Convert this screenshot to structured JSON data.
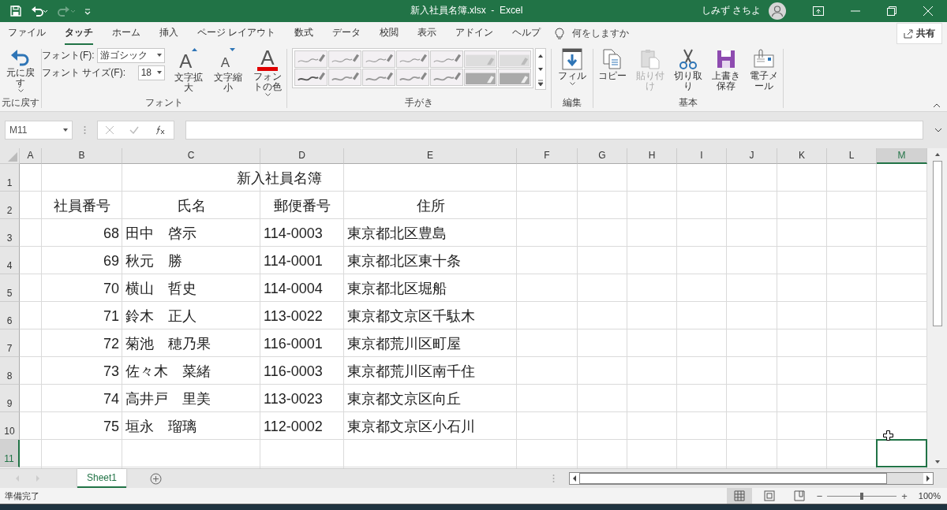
{
  "title_bar": {
    "title": "新入社員名簿.xlsx  -  Excel",
    "user": "しみず さちよ"
  },
  "tabs": [
    {
      "label": "ファイル",
      "selected": false
    },
    {
      "label": "タッチ",
      "selected": true
    },
    {
      "label": "ホーム",
      "selected": false
    },
    {
      "label": "挿入",
      "selected": false
    },
    {
      "label": "ページ レイアウト",
      "selected": false
    },
    {
      "label": "数式",
      "selected": false
    },
    {
      "label": "データ",
      "selected": false
    },
    {
      "label": "校閲",
      "selected": false
    },
    {
      "label": "表示",
      "selected": false
    },
    {
      "label": "アドイン",
      "selected": false
    },
    {
      "label": "ヘルプ",
      "selected": false
    }
  ],
  "tell_me": "何をしますか",
  "share": "共有",
  "ribbon": {
    "undo": {
      "label": "元に戻す",
      "group": "元に戻す"
    },
    "font": {
      "font_label": "フォント(F):",
      "font_value": "游ゴシック",
      "size_label": "フォント サイズ(F):",
      "size_value": "18",
      "grow_glyph": "A",
      "grow": "文字拡大",
      "shrink_glyph": "A",
      "shrink": "文字縮小",
      "color_glyph": "A",
      "color_button": "フォントの色",
      "group": "フォント"
    },
    "pens": {
      "group": "手がき"
    },
    "edit": {
      "fill": "フィル",
      "group": "編集"
    },
    "basic": {
      "buttons": [
        {
          "kind": "copy",
          "label": "コピー",
          "disabled": false
        },
        {
          "kind": "paste",
          "label": "貼り付け",
          "disabled": true
        },
        {
          "kind": "cut",
          "label": "切り取り",
          "disabled": false
        },
        {
          "kind": "save",
          "label": "上書き保存",
          "disabled": false
        },
        {
          "kind": "mail",
          "label": "電子メール",
          "disabled": false
        }
      ],
      "group": "基本"
    }
  },
  "name_box": "M11",
  "columns": [
    {
      "label": "A",
      "selected": false
    },
    {
      "label": "B",
      "selected": false
    },
    {
      "label": "C",
      "selected": false
    },
    {
      "label": "D",
      "selected": false
    },
    {
      "label": "E",
      "selected": false
    },
    {
      "label": "F",
      "selected": false
    },
    {
      "label": "G",
      "selected": false
    },
    {
      "label": "H",
      "selected": false
    },
    {
      "label": "I",
      "selected": false
    },
    {
      "label": "J",
      "selected": false
    },
    {
      "label": "K",
      "selected": false
    },
    {
      "label": "L",
      "selected": false
    },
    {
      "label": "M",
      "selected": true
    }
  ],
  "rows": [
    {
      "number": "1",
      "selected": false,
      "kind": "title",
      "cells": [
        "新入社員名簿"
      ]
    },
    {
      "number": "2",
      "selected": false,
      "kind": "header",
      "cells": [
        "社員番号",
        "氏名",
        "郵便番号",
        "住所"
      ]
    },
    {
      "number": "3",
      "selected": false,
      "kind": "data",
      "cells": [
        "68",
        "田中　啓示",
        "114-0003",
        "東京都北区豊島"
      ]
    },
    {
      "number": "4",
      "selected": false,
      "kind": "data",
      "cells": [
        "69",
        "秋元　勝",
        "114-0001",
        "東京都北区東十条"
      ]
    },
    {
      "number": "5",
      "selected": false,
      "kind": "data",
      "cells": [
        "70",
        "横山　哲史",
        "114-0004",
        "東京都北区堀船"
      ]
    },
    {
      "number": "6",
      "selected": false,
      "kind": "data",
      "cells": [
        "71",
        "鈴木　正人",
        "113-0022",
        "東京都文京区千駄木"
      ]
    },
    {
      "number": "7",
      "selected": false,
      "kind": "data",
      "cells": [
        "72",
        "菊池　穂乃果",
        "116-0001",
        "東京都荒川区町屋"
      ]
    },
    {
      "number": "8",
      "selected": false,
      "kind": "data",
      "cells": [
        "73",
        "佐々木　菜緒",
        "116-0003",
        "東京都荒川区南千住"
      ]
    },
    {
      "number": "9",
      "selected": false,
      "kind": "data",
      "cells": [
        "74",
        "高井戸　里美",
        "113-0023",
        "東京都文京区向丘"
      ]
    },
    {
      "number": "10",
      "selected": false,
      "kind": "data",
      "cells": [
        "75",
        "垣永　瑠璃",
        "112-0002",
        "東京都文京区小石川"
      ]
    },
    {
      "number": "11",
      "selected": true,
      "kind": "empty",
      "cells": []
    }
  ],
  "sheets": [
    {
      "label": "Sheet1",
      "selected": true
    }
  ],
  "status": "準備完了",
  "views": [
    {
      "kind": "normal",
      "selected": true
    },
    {
      "kind": "layout",
      "selected": false
    },
    {
      "kind": "pagebreak",
      "selected": false
    }
  ],
  "zoom": {
    "out": "−",
    "in": "+",
    "level": 0.5,
    "label": "100%"
  }
}
